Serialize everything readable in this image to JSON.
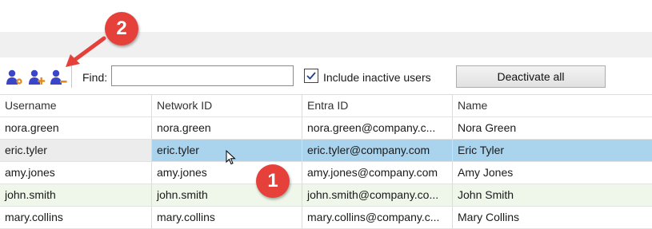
{
  "toolbar": {
    "icons": [
      "user-settings-icon",
      "add-user-icon",
      "remove-user-icon"
    ],
    "find_label": "Find:",
    "find_value": "",
    "find_placeholder": "",
    "include_inactive_label": "Include inactive users",
    "include_inactive_checked": true,
    "deactivate_label": "Deactivate all"
  },
  "table": {
    "columns": [
      "Username",
      "Network ID",
      "Entra ID",
      "Name"
    ],
    "rows": [
      {
        "username": "nora.green",
        "network_id": "nora.green",
        "entra_id": "nora.green@company.c...",
        "name": "Nora Green"
      },
      {
        "username": "eric.tyler",
        "network_id": "eric.tyler",
        "entra_id": "eric.tyler@company.com",
        "name": "Eric Tyler"
      },
      {
        "username": "amy.jones",
        "network_id": "amy.jones",
        "entra_id": "amy.jones@company.com",
        "name": "Amy Jones"
      },
      {
        "username": "john.smith",
        "network_id": "john.smith",
        "entra_id": "john.smith@company.co...",
        "name": "John Smith"
      },
      {
        "username": "mary.collins",
        "network_id": "mary.collins",
        "entra_id": "mary.collins@company.c...",
        "name": "Mary Collins"
      }
    ],
    "selected_row": "eric.tyler"
  },
  "callouts": {
    "badge_1": "1",
    "badge_2": "2"
  },
  "colors": {
    "icon_blue": "#3a45c8",
    "badge_red": "#e5403a",
    "selection_blue": "#aad3ee",
    "alt_row_green": "#eef7ea"
  }
}
